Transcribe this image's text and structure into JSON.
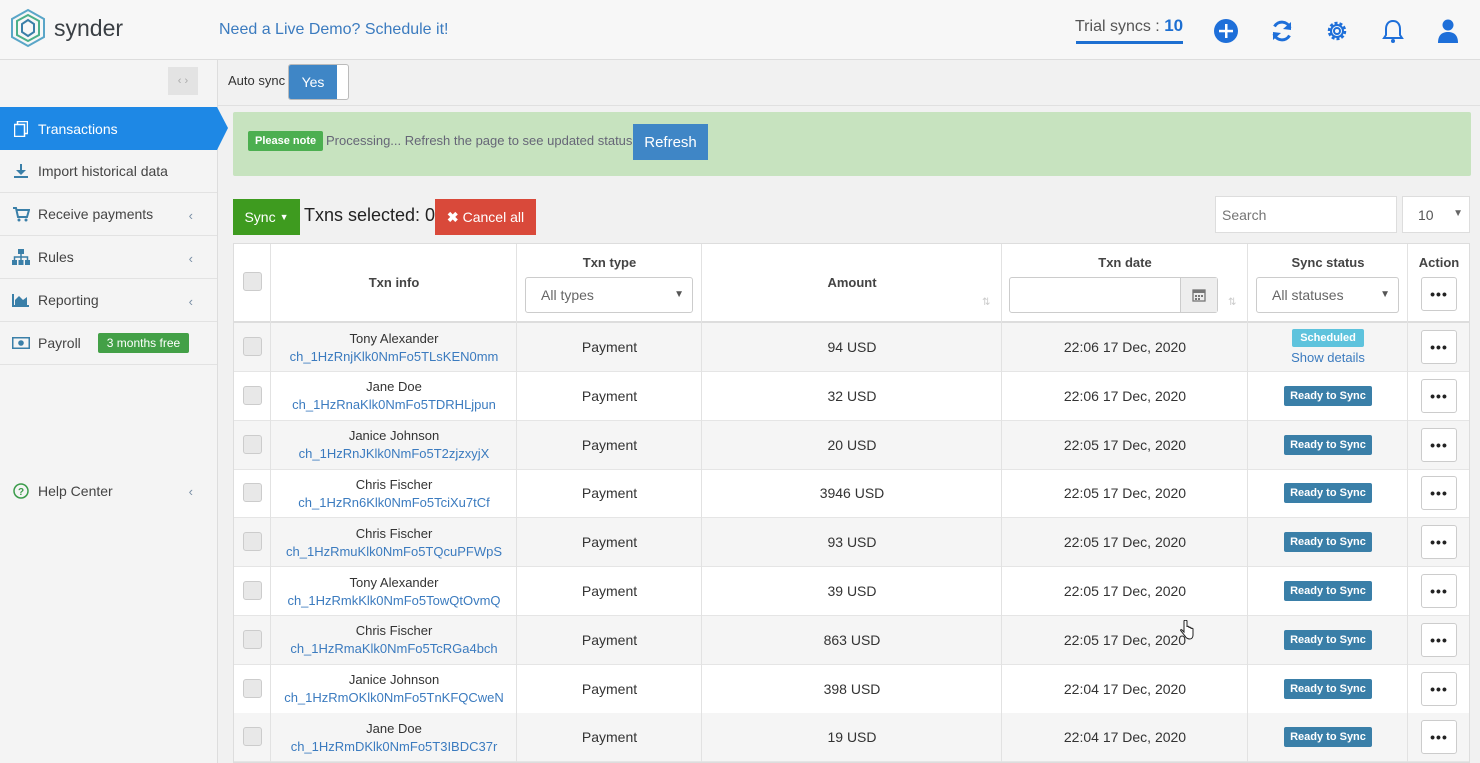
{
  "header": {
    "brand": "synder",
    "demo_link": "Need a Live Demo? Schedule it!",
    "trial_label": "Trial syncs : ",
    "trial_count": "10",
    "icons": [
      "plus-circle-icon",
      "refresh-icon",
      "gear-icon",
      "bell-icon",
      "user-icon"
    ]
  },
  "sidebar": {
    "collapse_glyph": "‹ ›",
    "items": [
      {
        "label": "Transactions",
        "icon": "transactions-icon",
        "active": true
      },
      {
        "label": "Import historical data",
        "icon": "download-icon"
      },
      {
        "label": "Receive payments",
        "icon": "cart-icon"
      },
      {
        "label": "Rules",
        "icon": "sitemap-icon"
      },
      {
        "label": "Reporting",
        "icon": "area-chart-icon"
      },
      {
        "label": "Payroll",
        "icon": "money-icon",
        "badge": "3 months free"
      },
      {
        "label": "Help Center",
        "icon": "help-icon"
      }
    ]
  },
  "autosync": {
    "label": "Auto sync",
    "value": "Yes"
  },
  "notice": {
    "tag": "Please note",
    "message": "Processing... Refresh the page to see updated status.",
    "button": "Refresh"
  },
  "toolbar": {
    "sync_label": "Sync",
    "selected_text": "Txns selected: 0",
    "cancel_label": "Cancel all",
    "search_placeholder": "Search",
    "page_size": "10"
  },
  "table": {
    "columns": {
      "txn_info": "Txn info",
      "txn_type": "Txn type",
      "amount": "Amount",
      "txn_date": "Txn date",
      "sync_status": "Sync status",
      "action": "Action"
    },
    "filters": {
      "type": "All types",
      "status": "All statuses"
    },
    "rows": [
      {
        "name": "Tony Alexander",
        "id": "ch_1HzRnjKlk0NmFo5TLsKEN0mm",
        "type": "Payment",
        "amount": "94 USD",
        "date": "22:06 17 Dec, 2020",
        "status": "Scheduled",
        "details": "Show details"
      },
      {
        "name": "Jane Doe",
        "id": "ch_1HzRnaKlk0NmFo5TDRHLjpun",
        "type": "Payment",
        "amount": "32 USD",
        "date": "22:06 17 Dec, 2020",
        "status": "Ready to Sync"
      },
      {
        "name": "Janice Johnson",
        "id": "ch_1HzRnJKlk0NmFo5T2zjzxyjX",
        "type": "Payment",
        "amount": "20 USD",
        "date": "22:05 17 Dec, 2020",
        "status": "Ready to Sync"
      },
      {
        "name": "Chris Fischer",
        "id": "ch_1HzRn6Klk0NmFo5TciXu7tCf",
        "type": "Payment",
        "amount": "3946 USD",
        "date": "22:05 17 Dec, 2020",
        "status": "Ready to Sync"
      },
      {
        "name": "Chris Fischer",
        "id": "ch_1HzRmuKlk0NmFo5TQcuPFWpS",
        "type": "Payment",
        "amount": "93 USD",
        "date": "22:05 17 Dec, 2020",
        "status": "Ready to Sync"
      },
      {
        "name": "Tony Alexander",
        "id": "ch_1HzRmkKlk0NmFo5TowQtOvmQ",
        "type": "Payment",
        "amount": "39 USD",
        "date": "22:05 17 Dec, 2020",
        "status": "Ready to Sync"
      },
      {
        "name": "Chris Fischer",
        "id": "ch_1HzRmaKlk0NmFo5TcRGa4bch",
        "type": "Payment",
        "amount": "863 USD",
        "date": "22:05 17 Dec, 2020",
        "status": "Ready to Sync"
      },
      {
        "name": "Janice Johnson",
        "id": "ch_1HzRmOKlk0NmFo5TnKFQCweN",
        "type": "Payment",
        "amount": "398 USD",
        "date": "22:04 17 Dec, 2020",
        "status": "Ready to Sync"
      },
      {
        "name": "Jane Doe",
        "id": "ch_1HzRmDKlk0NmFo5T3IBDC37r",
        "type": "Payment",
        "amount": "19 USD",
        "date": "22:04 17 Dec, 2020",
        "status": "Ready to Sync"
      }
    ],
    "action_glyph": "•••"
  },
  "colors": {
    "primary": "#1e88e5",
    "button_blue": "#3f86c6",
    "sync_green": "#3e9b1f",
    "cancel_red": "#d9493a",
    "ready_badge": "#3a7fa8",
    "scheduled_badge": "#5ec3dd"
  }
}
